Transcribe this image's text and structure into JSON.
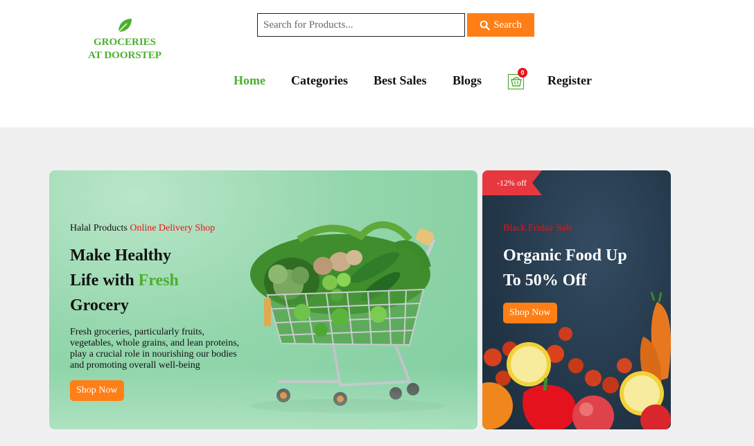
{
  "logo": {
    "line1": "GROCERIES",
    "line2": "AT DOORSTEP",
    "icon": "leaf-icon",
    "color": "#4caf2f"
  },
  "search": {
    "placeholder": "Search for Products...",
    "value": "",
    "button_label": "Search",
    "icon": "search-icon"
  },
  "nav": {
    "items": [
      {
        "label": "Home",
        "active": true
      },
      {
        "label": "Categories",
        "active": false
      },
      {
        "label": "Best Sales",
        "active": false
      },
      {
        "label": "Blogs",
        "active": false
      },
      {
        "label": "Register",
        "active": false
      }
    ],
    "cart": {
      "icon": "basket-icon",
      "count": "0"
    }
  },
  "hero": {
    "tag_prefix": "Halal Products",
    "tag_highlight": "Online Delivery Shop",
    "title_line1": "Make Healthy",
    "title_line2_prefix": "Life with",
    "title_line2_highlight": "Fresh",
    "title_line3": "Grocery",
    "description": "Fresh groceries, particularly fruits, vegetables, whole grains, and lean proteins, play a crucial role in nourishing our bodies and promoting overall well-being",
    "button_label": "Shop Now",
    "image": "shopping-cart-with-vegetables"
  },
  "offer": {
    "badge": "-12% off",
    "label": "Black Friday Sale",
    "title_line1": "Organic Food Up",
    "title_line2": "To 50% Off",
    "button_label": "Shop Now",
    "image": "fresh-fruits-and-vegetables"
  },
  "colors": {
    "accent": "#ff7f16",
    "brand_green": "#4caf2f",
    "red": "#e8131b",
    "page_bg": "#f0f0f0"
  }
}
